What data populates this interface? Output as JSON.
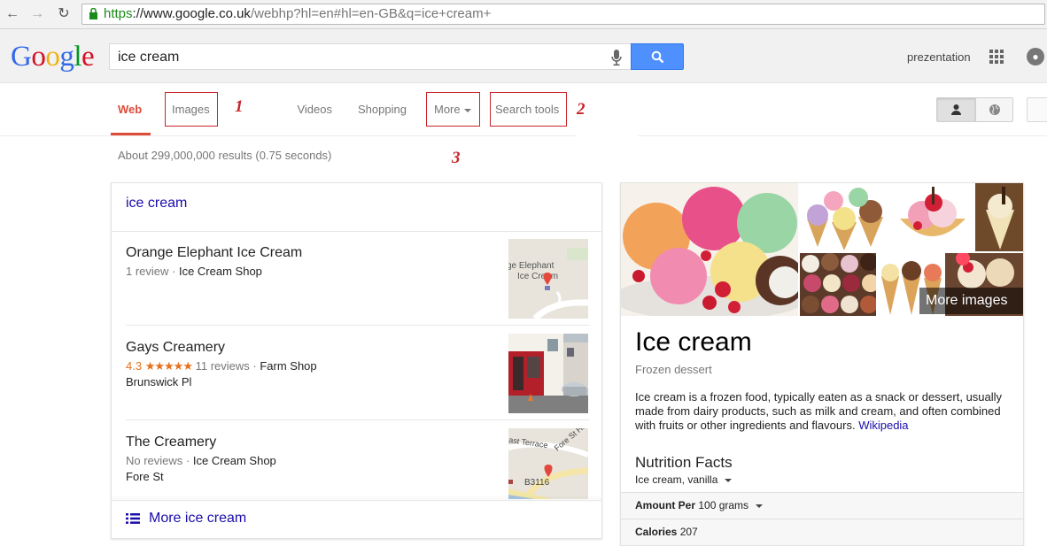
{
  "browser": {
    "url_scheme": "https",
    "url_host": "://www.google.co.uk",
    "url_rest": "/webhp?hl=en#hl=en-GB&q=ice+cream+"
  },
  "header": {
    "logo": [
      "G",
      "o",
      "o",
      "g",
      "l",
      "e"
    ],
    "logo_colors": [
      "#3369e8",
      "#d50f25",
      "#eeb211",
      "#3369e8",
      "#009925",
      "#d50f25"
    ],
    "query": "ice cream",
    "username": "prezentation"
  },
  "tabs": {
    "web": "Web",
    "images": "Images",
    "videos": "Videos",
    "shopping": "Shopping",
    "more": "More",
    "search_tools": "Search tools"
  },
  "annotations": {
    "m1": "1",
    "m2": "2",
    "m3": "3",
    "box_color": "#c8242a"
  },
  "stats": "About 299,000,000 results (0.75 seconds)",
  "local": {
    "heading": "ice cream",
    "places": [
      {
        "name": "Orange Elephant Ice Cream",
        "meta": "1 review · ",
        "type": "Ice Cream Shop",
        "address": "",
        "map_label": "ge Elephant\nIce Cream"
      },
      {
        "name": "Gays Creamery",
        "rating": "4.3",
        "stars": "★★★★★",
        "reviews": "11 reviews · ",
        "type": "Farm Shop",
        "address": "Brunswick Pl"
      },
      {
        "name": "The Creamery",
        "meta": "No reviews · ",
        "type": "Ice Cream Shop",
        "address": "Fore St",
        "map_label": "B3116",
        "map_label2": "ast Terrace",
        "map_label3": "Fore St Hill"
      }
    ],
    "more": "More ice cream"
  },
  "knowledge": {
    "more_images": "More images",
    "title": "Ice cream",
    "subtitle": "Frozen dessert",
    "description": "Ice cream is a frozen food, typically eaten as a snack or dessert, usually made from dairy products, such as milk and cream, and often combined with fruits or other ingredients and flavours. ",
    "source": "Wikipedia",
    "nutrition_title": "Nutrition Facts",
    "nutrition_item": "Ice cream, vanilla",
    "amount_label": "Amount Per",
    "amount_value": "100 grams",
    "calories_label": "Calories",
    "calories_value": "207"
  },
  "colors": {
    "accent": "#dd4b39",
    "link": "#1a0dab",
    "search_button": "#4d90fe"
  }
}
